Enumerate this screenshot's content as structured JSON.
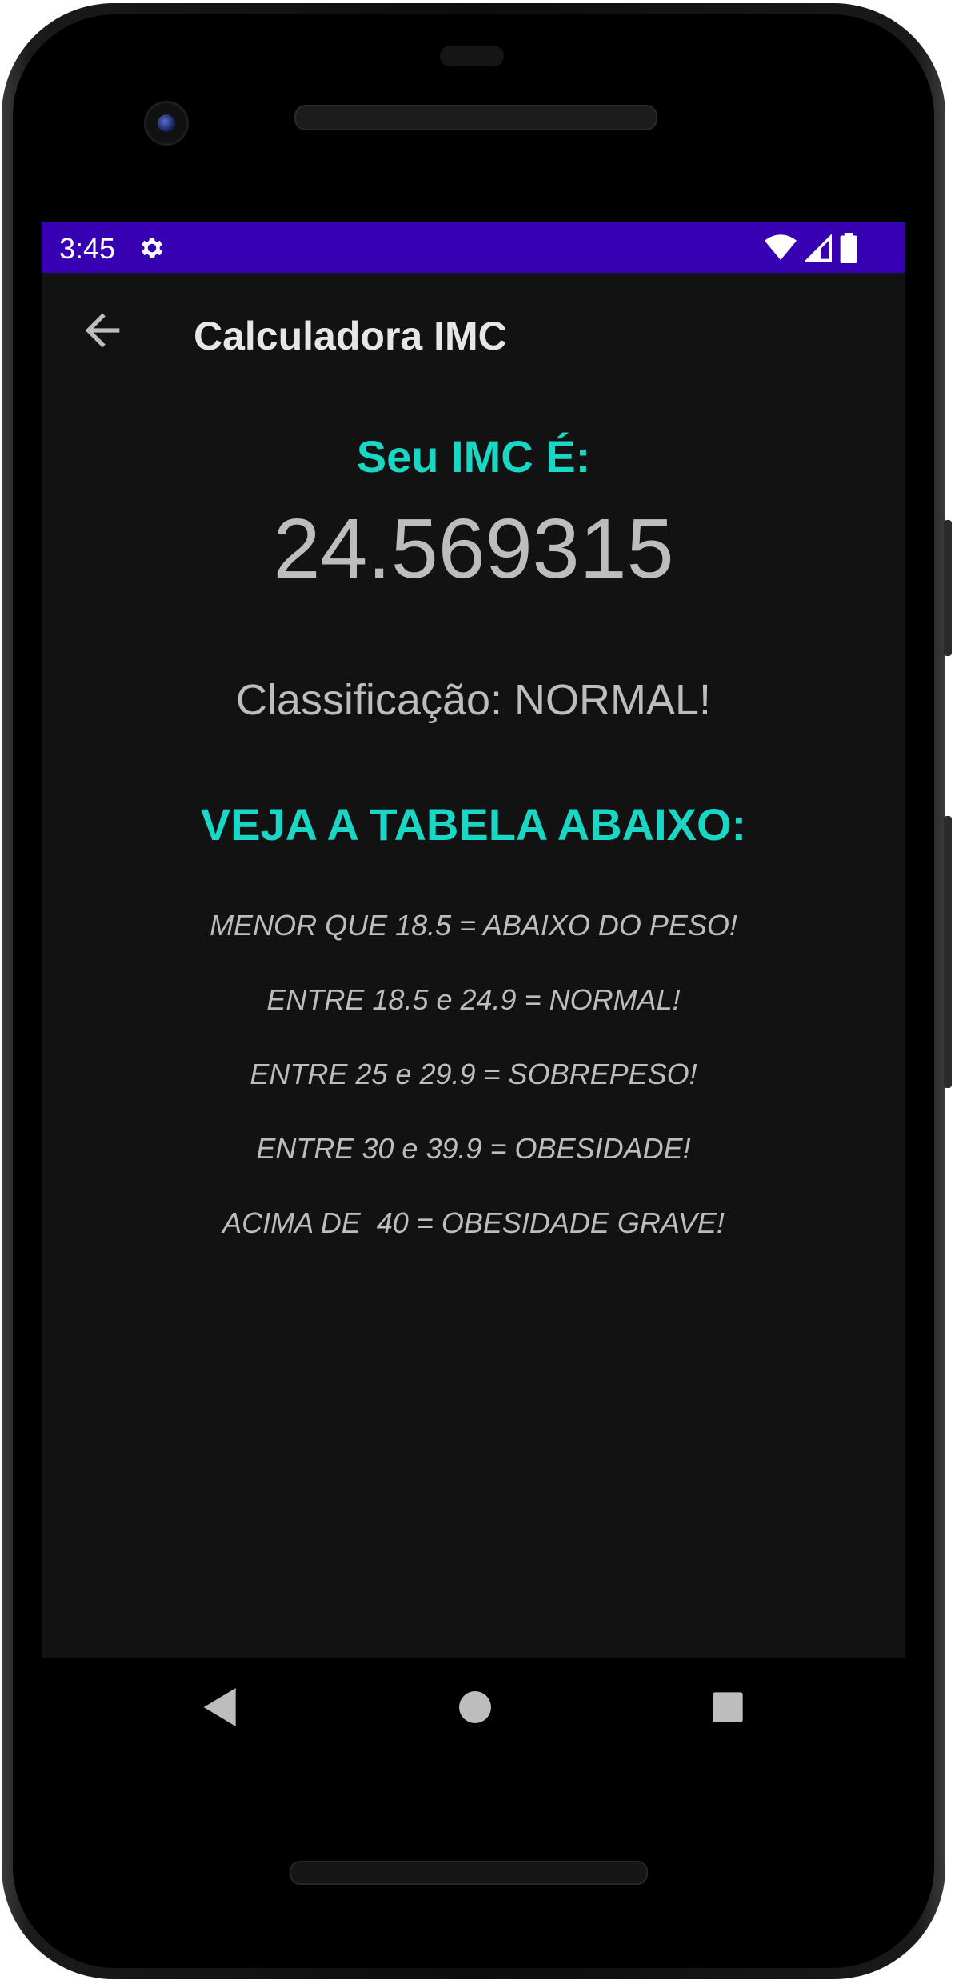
{
  "status_bar": {
    "time": "3:45",
    "left_icons": [
      "gear-icon"
    ],
    "right_icons": [
      "wifi-icon",
      "cell-signal-icon",
      "battery-icon"
    ],
    "background": "#3700b3"
  },
  "app_bar": {
    "title": "Calculadora IMC",
    "back_icon": "arrow-back-icon"
  },
  "result": {
    "heading": "Seu IMC É:",
    "value": "24.569315",
    "classification": "Classificação: NORMAL!"
  },
  "table": {
    "heading": "VEJA A TABELA ABAIXO:",
    "rows": [
      "MENOR QUE 18.5 = ABAIXO DO PESO!",
      "ENTRE 18.5 e 24.9 = NORMAL!",
      "ENTRE 25 e 29.9 = SOBREPESO!",
      "ENTRE 30 e 39.9 = OBESIDADE!",
      "ACIMA DE  40 = OBESIDADE GRAVE!"
    ]
  },
  "nav_bar": {
    "items": [
      "back-triangle-icon",
      "home-circle-icon",
      "recents-square-icon"
    ]
  },
  "colors": {
    "accent": "#1ad6c4",
    "screen_background": "#121212",
    "text": "#bdbdbd",
    "status_bar": "#3700b3"
  }
}
